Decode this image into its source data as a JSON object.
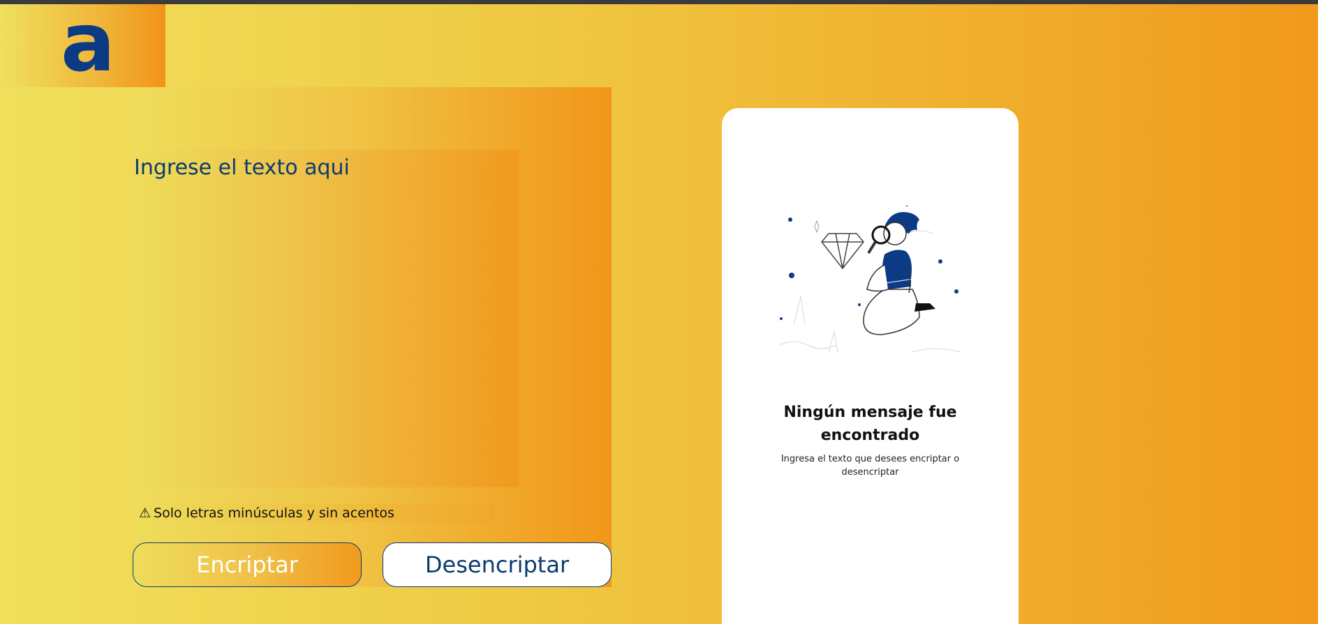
{
  "logo": {
    "letter": "a"
  },
  "input": {
    "placeholder": "Ingrese el texto aqui"
  },
  "warning": {
    "icon": "warning-icon",
    "text": "Solo letras minúsculas y sin acentos"
  },
  "buttons": {
    "encrypt": "Encriptar",
    "decrypt": "Desencriptar"
  },
  "output": {
    "title": "Ningún mensaje fue encontrado",
    "subtitle": "Ingresa el texto que desees encriptar o desencriptar"
  },
  "colors": {
    "accent": "#0b3b6e",
    "gradient_start": "#f0e05c",
    "gradient_end": "#f19a1c"
  }
}
